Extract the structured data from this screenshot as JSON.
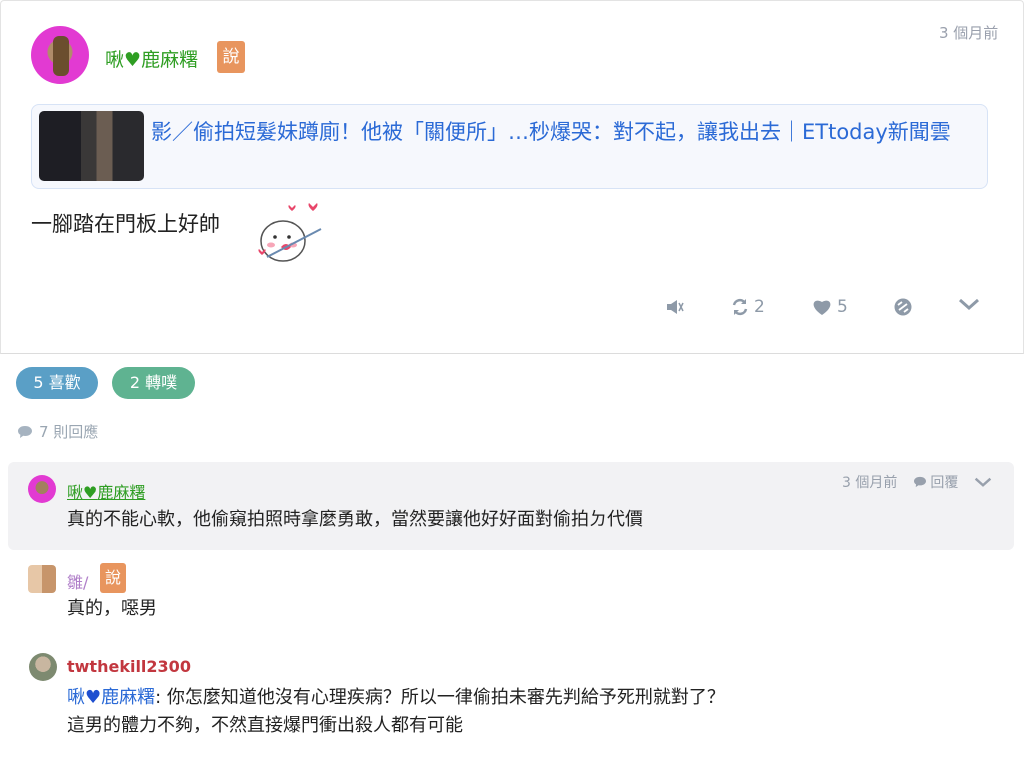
{
  "post": {
    "author": {
      "name_a": "啾",
      "name_b": "鹿麻糬"
    },
    "badge": "說",
    "time": "3 個月前",
    "link": {
      "title": "影／偷拍短髮妹蹲廁！他被「關便所」…秒爆哭：對不起，讓我出去｜ETtoday新聞雲"
    },
    "text": "一腳踏在門板上好帥",
    "actions": {
      "replurk_count": "2",
      "like_count": "5"
    }
  },
  "stats": {
    "likes_label": "5 喜歡",
    "replurks_label": "2 轉噗",
    "responses_label": "7 則回應"
  },
  "comments": [
    {
      "name_a": "啾",
      "name_b": "鹿麻糬",
      "time": "3 個月前",
      "reply_label": "回覆",
      "text": "真的不能心軟，他偷窺拍照時拿麼勇敢，當然要讓他好好面對偷拍ㄉ代價"
    },
    {
      "name": "雛/",
      "badge": "說",
      "text": "真的，噁男"
    },
    {
      "name": "twthekill2300",
      "mention_a": "啾",
      "mention_b": "鹿麻糬",
      "text_1": ": 你怎麼知道他沒有心理疾病？所以一律偷拍未審先判給予死刑就對了？",
      "text_2": "這男的體力不夠，不然直接爆門衝出殺人都有可能"
    }
  ],
  "colors": {
    "accent_green": "#2f9e23",
    "like_pill": "#5a9fc6",
    "replurk_pill": "#5fb391",
    "badge_orange": "#e8955e",
    "link_blue": "#2b6ad6"
  }
}
